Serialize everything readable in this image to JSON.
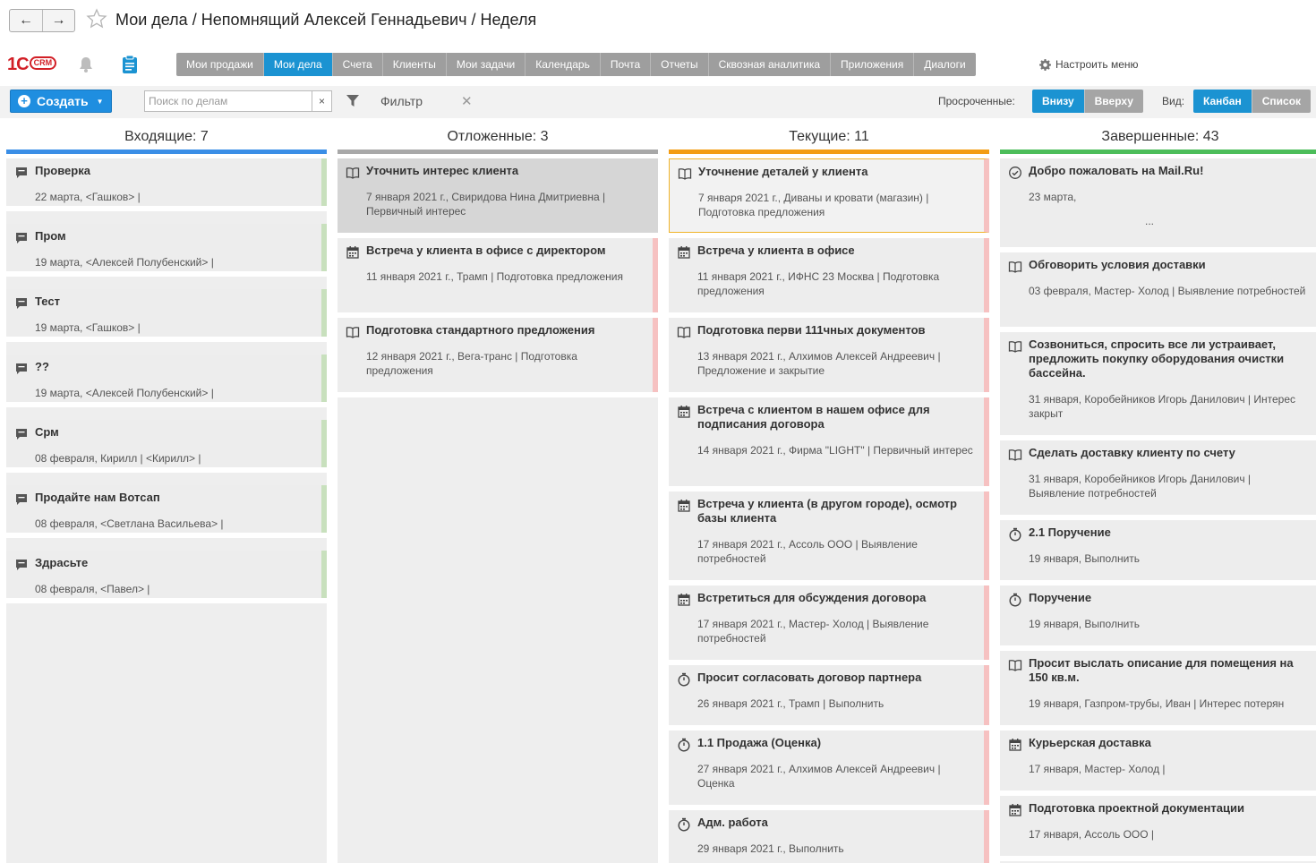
{
  "window": {
    "title": "Мои дела / Непомнящий Алексей Геннадьевич / Неделя"
  },
  "toolbar": {
    "logo_main": "1С",
    "logo_sub": "CRM",
    "menu": [
      "Мои продажи",
      "Мои дела",
      "Счета",
      "Клиенты",
      "Мои задачи",
      "Календарь",
      "Почта",
      "Отчеты",
      "Сквозная аналитика",
      "Приложения",
      "Диалоги"
    ],
    "active_menu": "Мои дела",
    "configure_label": "Настроить меню"
  },
  "commandbar": {
    "create_label": "Создать",
    "search_placeholder": "Поиск по делам",
    "filter_label": "Фильтр",
    "overdue_label": "Просроченные:",
    "overdue_options": [
      "Внизу",
      "Вверху"
    ],
    "overdue_selected": "Внизу",
    "view_label": "Вид:",
    "view_options": [
      "Канбан",
      "Список"
    ],
    "view_selected": "Канбан"
  },
  "columns": [
    {
      "title": "Входящие: 7",
      "color": "#3a8ee6",
      "cards": [
        {
          "icon": "chat-icon",
          "title": "Проверка",
          "meta": "22 марта,   <Гашков> |",
          "accent": "green"
        },
        {
          "icon": "chat-icon",
          "title": "Пром",
          "meta": "19 марта,   <Алексей Полубенский> |",
          "accent": "green"
        },
        {
          "icon": "chat-icon",
          "title": "Тест",
          "meta": "19 марта,   <Гашков> |",
          "accent": "green"
        },
        {
          "icon": "chat-icon",
          "title": "??",
          "meta": "19 марта,   <Алексей Полубенский> |",
          "accent": "green"
        },
        {
          "icon": "chat-icon",
          "title": "Срм",
          "meta": "08 февраля, Кирилл |   <Кирилл> |",
          "accent": "green"
        },
        {
          "icon": "chat-icon",
          "title": "Продайте нам Вотсап",
          "meta": "08 февраля,   <Светлана Васильева> |",
          "accent": "green"
        },
        {
          "icon": "chat-icon",
          "title": "Здрасьте",
          "meta": "08 февраля,   <Павел> |",
          "accent": "green"
        }
      ]
    },
    {
      "title": "Отложенные: 3",
      "color": "#a8a8a8",
      "cards": [
        {
          "icon": "book-icon",
          "title": "Уточнить интерес клиента",
          "meta": "7 января 2021 г., Свиридова Нина Дмитриевна | Первичный интерес",
          "accent": "none",
          "selected": true
        },
        {
          "icon": "calendar-icon",
          "title": "Встреча у клиента в офисе с директором",
          "meta": "11 января 2021 г., Трамп | Подготовка предложения",
          "accent": "red"
        },
        {
          "icon": "book-icon",
          "title": "Подготовка стандартного предложения",
          "meta": "12 января 2021 г., Вега-транс | Подготовка предложения",
          "accent": "red"
        }
      ]
    },
    {
      "title": "Текущие: 11",
      "color": "#f39c12",
      "cards": [
        {
          "icon": "book-icon",
          "title": "Уточнение деталей у клиента",
          "meta": "7 января 2021 г., Диваны и кровати (магазин) | Подготовка предложения",
          "accent": "red",
          "highlighted": true
        },
        {
          "icon": "calendar-icon",
          "title": "Встреча у клиента в офисе",
          "meta": "11 января 2021 г., ИФНС 23 Москва | Подготовка предложения",
          "accent": "red"
        },
        {
          "icon": "book-icon",
          "title": "Подготовка перви 111чных документов",
          "meta": "13 января 2021 г., Алхимов Алексей Андреевич | Предложение и закрытие",
          "accent": "red"
        },
        {
          "icon": "calendar-icon",
          "title": "Встреча с клиентом в нашем офисе для подписания договора",
          "meta": "14 января 2021 г., Фирма \"LIGHT\" | Первичный интерес",
          "accent": "red"
        },
        {
          "icon": "calendar-icon",
          "title": "Встреча у клиента (в другом городе), осмотр базы клиента",
          "meta": "17 января 2021 г., Ассоль ООО | Выявление потребностей",
          "accent": "red"
        },
        {
          "icon": "calendar-icon",
          "title": "Встретиться для обсуждения договора",
          "meta": "17 января 2021 г., Мастер- Холод | Выявление потребностей",
          "accent": "red"
        },
        {
          "icon": "stopwatch-icon",
          "title": "Просит согласовать договор партнера",
          "meta": "26 января 2021 г., Трамп | Выполнить",
          "accent": "red"
        },
        {
          "icon": "stopwatch-icon",
          "title": "1.1 Продажа (Оценка)",
          "meta": "27 января 2021 г., Алхимов Алексей Андреевич | Оценка",
          "accent": "red"
        },
        {
          "icon": "stopwatch-icon",
          "title": "Адм. работа",
          "meta": "29 января 2021 г., Выполнить",
          "accent": "red"
        }
      ]
    },
    {
      "title": "Завершенные: 43",
      "color": "#4cbd5a",
      "cards": [
        {
          "icon": "check-circle-icon",
          "title": "Добро пожаловать на Mail.Ru!",
          "meta": "23 марта,",
          "extra": "...",
          "accent": "none"
        },
        {
          "icon": "book-icon",
          "title": "Обговорить условия доставки",
          "meta": "03 февраля, Мастер- Холод | Выявление потребностей",
          "accent": "none"
        },
        {
          "icon": "book-icon",
          "title": "Созвониться, спросить все ли устраивает, предложить покупку оборудования очистки бассейна.",
          "meta": "31 января, Коробейников Игорь Данилович | Интерес закрыт",
          "accent": "none"
        },
        {
          "icon": "book-icon",
          "title": "Сделать доставку клиенту по счету",
          "meta": "31 января, Коробейников Игорь Данилович | Выявление потребностей",
          "accent": "none"
        },
        {
          "icon": "stopwatch-icon",
          "title": "2.1 Поручение",
          "meta": "19 января, Выполнить",
          "accent": "none"
        },
        {
          "icon": "stopwatch-icon",
          "title": "Поручение",
          "meta": "19 января, Выполнить",
          "accent": "none"
        },
        {
          "icon": "book-icon",
          "title": "Просит выслать описание для помещения на 150 кв.м.",
          "meta": "19 января, Газпром-трубы, Иван | Интерес потерян",
          "accent": "none"
        },
        {
          "icon": "calendar-icon",
          "title": "Курьерская доставка",
          "meta": "17 января, Мастер- Холод |",
          "accent": "none"
        },
        {
          "icon": "calendar-icon",
          "title": "Подготовка проектной документации",
          "meta": "17 января, Ассоль ООО |",
          "accent": "none"
        }
      ]
    }
  ]
}
